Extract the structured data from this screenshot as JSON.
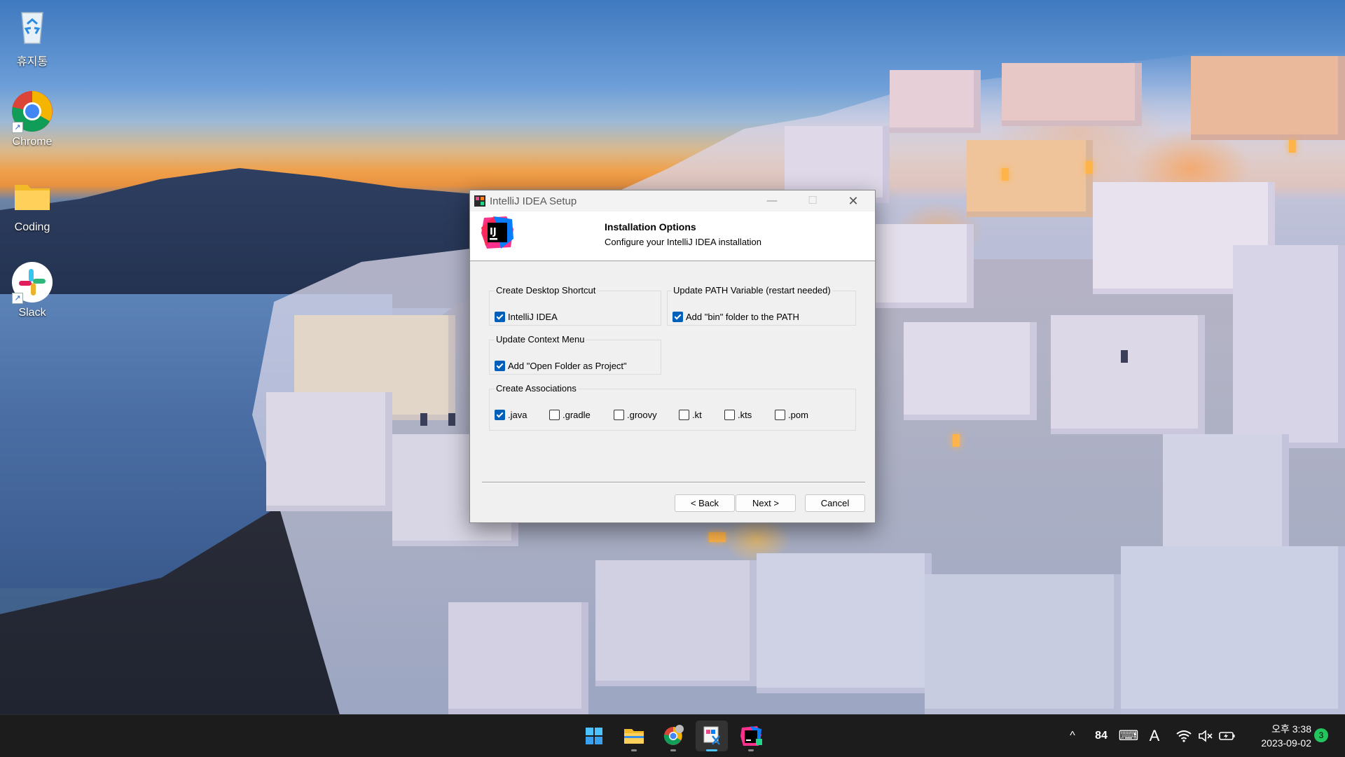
{
  "desktop": {
    "icons": [
      {
        "name": "recycle-bin",
        "label": "휴지통"
      },
      {
        "name": "chrome",
        "label": "Chrome"
      },
      {
        "name": "coding-folder",
        "label": "Coding"
      },
      {
        "name": "slack",
        "label": "Slack"
      }
    ]
  },
  "dialog": {
    "title": "IntelliJ IDEA Setup",
    "logo_text": "IJ",
    "header_title": "Installation Options",
    "header_subtitle": "Configure your IntelliJ IDEA installation",
    "groups": {
      "desktop_shortcut": {
        "label": "Create Desktop Shortcut",
        "options": [
          {
            "label": "IntelliJ IDEA",
            "checked": true
          }
        ]
      },
      "path_variable": {
        "label": "Update PATH Variable (restart needed)",
        "options": [
          {
            "label": "Add \"bin\" folder to the PATH",
            "checked": true
          }
        ]
      },
      "context_menu": {
        "label": "Update Context Menu",
        "options": [
          {
            "label": "Add \"Open Folder as Project\"",
            "checked": true
          }
        ]
      },
      "associations": {
        "label": "Create Associations",
        "options": [
          {
            "label": ".java",
            "checked": true
          },
          {
            "label": ".gradle",
            "checked": false
          },
          {
            "label": ".groovy",
            "checked": false
          },
          {
            "label": ".kt",
            "checked": false
          },
          {
            "label": ".kts",
            "checked": false
          },
          {
            "label": ".pom",
            "checked": false
          }
        ]
      }
    },
    "buttons": {
      "back": "< Back",
      "next": "Next >",
      "cancel": "Cancel"
    }
  },
  "taskbar": {
    "apps": [
      "start-icon",
      "file-explorer-icon",
      "chrome-icon",
      "snipping-tool-icon",
      "intellij-icon"
    ],
    "tray": {
      "overflow": "^",
      "badge_84": "84",
      "keyboard": "⌨",
      "ime": "A",
      "wifi": "wifi-icon",
      "volume": "volume-muted-icon",
      "battery": "battery-charging-icon"
    },
    "clock_time": "오후 3:38",
    "clock_date": "2023-09-02",
    "notification_count": "3"
  },
  "colors": {
    "accent": "#005fb8",
    "taskbar": "#1c1c1c",
    "dialog_bg": "#f0f0f0"
  }
}
